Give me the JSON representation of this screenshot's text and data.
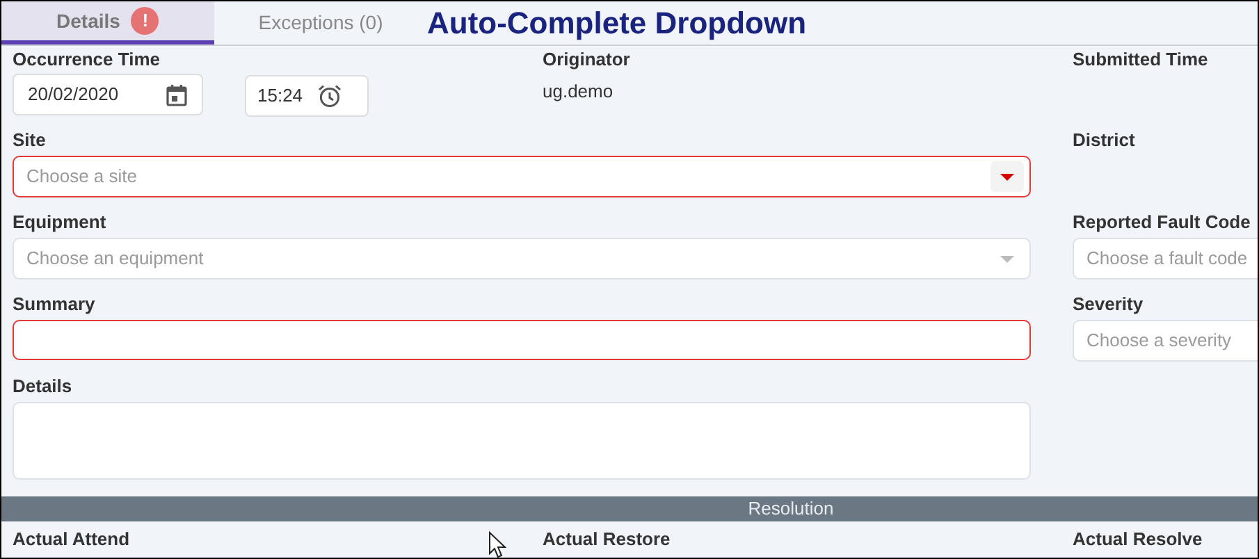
{
  "window": {
    "title": "Auto-Complete Dropdown"
  },
  "tabs": [
    {
      "label": "Details",
      "selected": true,
      "badge": "!"
    },
    {
      "label": "Exceptions (0)",
      "selected": false
    }
  ],
  "occurrence_time": {
    "label": "Occurrence Time",
    "date": "20/02/2020",
    "time": "15:24"
  },
  "originator": {
    "label": "Originator",
    "value": "ug.demo"
  },
  "submitted_time": {
    "label": "Submitted Time"
  },
  "fields": [
    {
      "label": "Site",
      "kind": "dropdown",
      "placeholder": "Choose a site",
      "invalid": true
    },
    {
      "label": "Equipment",
      "kind": "dropdown",
      "placeholder": "Choose an equipment",
      "invalid": false
    },
    {
      "label": "Summary",
      "kind": "text",
      "invalid": true
    },
    {
      "label": "Details",
      "kind": "textarea",
      "invalid": false
    }
  ],
  "side_fields": [
    {
      "label": "District",
      "kind": "label"
    },
    {
      "label": "Reported Fault Code",
      "kind": "dropdown",
      "placeholder": "Choose a fault code"
    },
    {
      "label": "Severity",
      "kind": "dropdown",
      "placeholder": "Choose a severity"
    }
  ],
  "section": {
    "title": "Resolution"
  },
  "resolution_labels": [
    "Actual Attend",
    "Actual Restore",
    "Actual Resolve"
  ]
}
